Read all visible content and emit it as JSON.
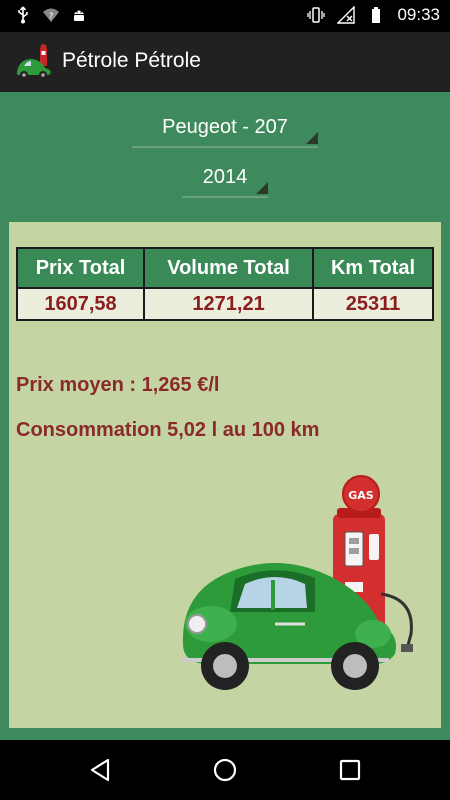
{
  "status_bar": {
    "time": "09:33",
    "left_icons": [
      "usb-icon",
      "wifi-question-icon",
      "android-icon"
    ],
    "right_icons": [
      "vibrate-icon",
      "no-signal-icon",
      "battery-icon"
    ]
  },
  "app_bar": {
    "title": "Pétrole Pétrole",
    "logo": "car-pump-logo"
  },
  "selectors": {
    "vehicle": "Peugeot - 207",
    "year": "2014"
  },
  "totals_table": {
    "headers": [
      "Prix Total",
      "Volume Total",
      "Km Total"
    ],
    "values": [
      "1607,58",
      "1271,21",
      "25311"
    ]
  },
  "stats": {
    "average_price": "Prix moyen : 1,265 €/l",
    "consumption": "Consommation 5,02 l au 100 km"
  },
  "illustration": {
    "gas_label": "GAS",
    "name": "green-beetle-gas-pump"
  },
  "nav_bar": {
    "buttons": [
      "back-icon",
      "home-icon",
      "recent-apps-icon"
    ]
  },
  "colors": {
    "background_green": "#3f8a5d",
    "panel": "#c4d4a2",
    "header_green": "#3a8a57",
    "value_red": "#8b1d1d",
    "app_bar": "#212121"
  }
}
